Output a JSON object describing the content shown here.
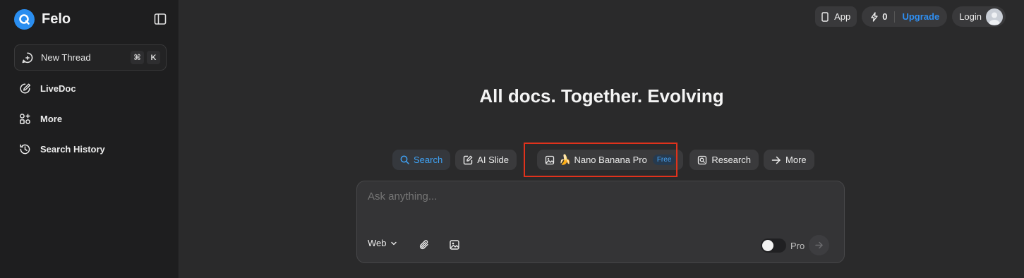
{
  "brand": {
    "name": "Felo"
  },
  "sidebar": {
    "new_thread": {
      "label": "New Thread",
      "shortcut_mod": "⌘",
      "shortcut_key": "K"
    },
    "items": [
      {
        "label": "LiveDoc",
        "icon": "edit-icon"
      },
      {
        "label": "More",
        "icon": "apps-icon"
      },
      {
        "label": "Search History",
        "icon": "history-icon"
      }
    ]
  },
  "header": {
    "app_label": "App",
    "credits": "0",
    "upgrade_label": "Upgrade",
    "login_label": "Login"
  },
  "main": {
    "headline": "All docs. Together. Evolving",
    "modes": [
      {
        "label": "Search",
        "icon": "search-icon",
        "active": true
      },
      {
        "label": "AI Slide",
        "icon": "slide-edit-icon"
      },
      {
        "label": "Nano Banana Pro",
        "icon": "image-icon",
        "emoji": "🍌",
        "badge": "Free"
      },
      {
        "label": "Research",
        "icon": "research-icon"
      },
      {
        "label": "More",
        "icon": "arrow-right-icon"
      }
    ],
    "composer": {
      "placeholder": "Ask anything...",
      "source_label": "Web",
      "pro_label": "Pro"
    }
  },
  "colors": {
    "accent": "#2f8ff2",
    "highlight": "#e0321c",
    "sidebar_bg": "#1e1e1f",
    "main_bg": "#2a2a2b"
  }
}
